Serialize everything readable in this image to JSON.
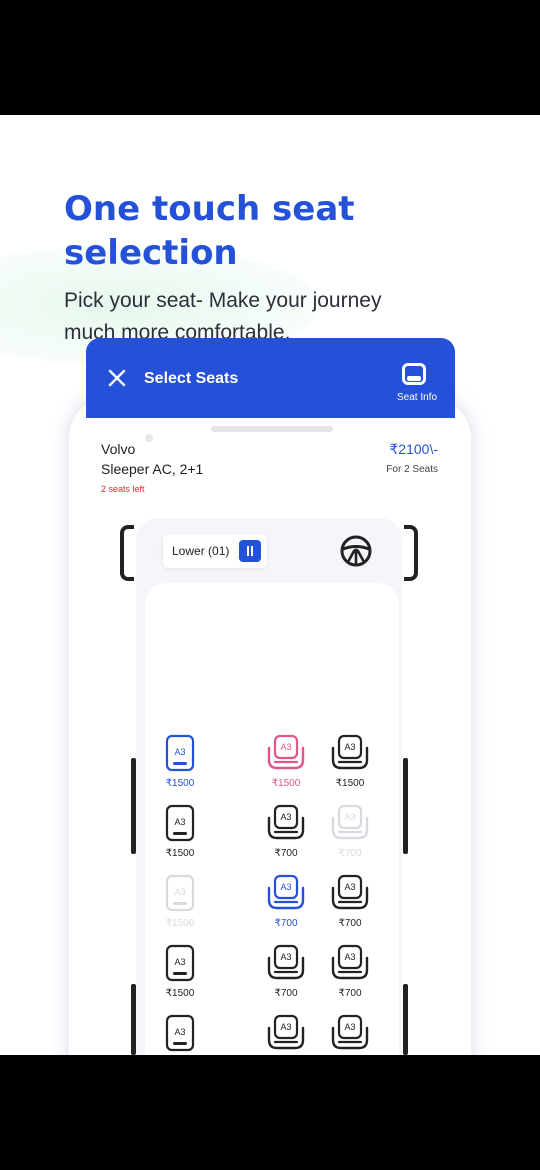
{
  "headline": {
    "line1": "One touch seat",
    "line2": "selection"
  },
  "subtitle": {
    "line1": "Pick your seat- Make your journey",
    "line2": "much more comfortable."
  },
  "appbar": {
    "title": "Select Seats",
    "seat_info_label": "Seat Info"
  },
  "bus": {
    "name": "Volvo",
    "type": "Sleeper AC, 2+1",
    "seats_left": "2 seats left",
    "price": "₹2100\\-",
    "price_note": "For 2 Seats"
  },
  "deck": {
    "label": "Lower (01)"
  },
  "colors": {
    "brand": "#2551d8",
    "pink": "#e0568c",
    "alert": "#e0312e"
  },
  "seats": [
    {
      "code": "A3",
      "price": "₹1500",
      "style": "sleeper",
      "state": "selected"
    },
    {
      "code": "A3",
      "price": "₹1500",
      "style": "seater",
      "state": "pink"
    },
    {
      "code": "A3",
      "price": "₹1500",
      "style": "seater",
      "state": "available"
    },
    {
      "code": "A3",
      "price": "₹1500",
      "style": "sleeper",
      "state": "available"
    },
    {
      "code": "A3",
      "price": "₹700",
      "style": "seater",
      "state": "available"
    },
    {
      "code": "A3",
      "price": "₹700",
      "style": "seater",
      "state": "booked"
    },
    {
      "code": "A3",
      "price": "₹1500",
      "style": "sleeper",
      "state": "booked"
    },
    {
      "code": "A3",
      "price": "₹700",
      "style": "seater",
      "state": "selected"
    },
    {
      "code": "A3",
      "price": "₹700",
      "style": "seater",
      "state": "available"
    },
    {
      "code": "A3",
      "price": "₹1500",
      "style": "sleeper",
      "state": "available"
    },
    {
      "code": "A3",
      "price": "₹700",
      "style": "seater",
      "state": "available"
    },
    {
      "code": "A3",
      "price": "₹700",
      "style": "seater",
      "state": "available"
    },
    {
      "code": "A3",
      "price": "",
      "style": "sleeper",
      "state": "available"
    },
    {
      "code": "A3",
      "price": "",
      "style": "seater",
      "state": "available"
    },
    {
      "code": "A3",
      "price": "",
      "style": "seater",
      "state": "available"
    }
  ]
}
